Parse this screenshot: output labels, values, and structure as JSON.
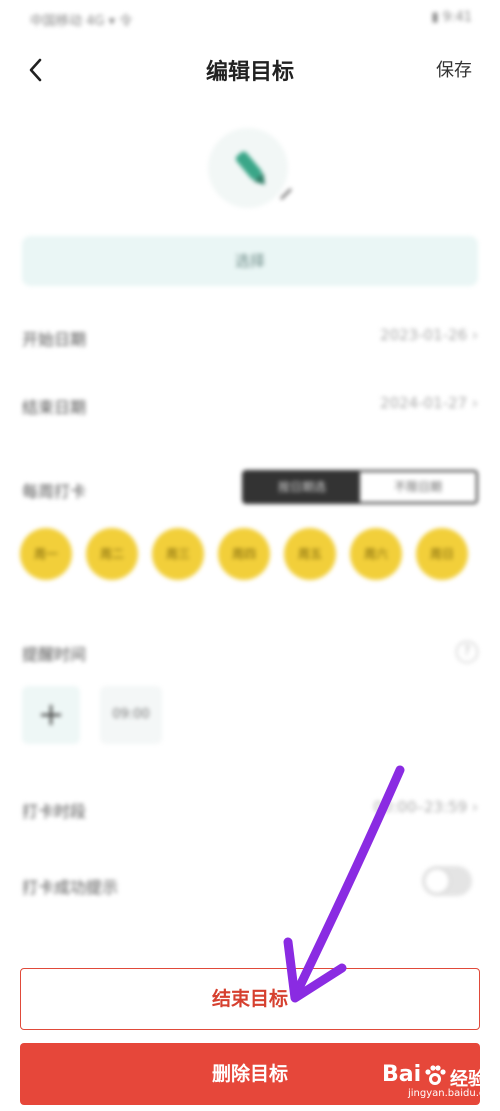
{
  "status_bar": {
    "left_text": "中国移动 4G ▾ 令",
    "right_text": "▮ 9:41"
  },
  "nav": {
    "back_icon": "chevron-left-icon",
    "title": "编辑目标",
    "save_label": "保存"
  },
  "goal": {
    "icon": "pencil-icon",
    "select_label": "选择"
  },
  "fields": {
    "start_date": {
      "label": "开始日期",
      "value": "2023-01-26 ›"
    },
    "end_date": {
      "label": "结束日期",
      "value": "2024-01-27 ›"
    }
  },
  "checkin": {
    "label": "每周打卡",
    "segments": [
      {
        "label": "按日期选",
        "active": true
      },
      {
        "label": "不限日期",
        "active": false
      }
    ],
    "days": [
      "周一",
      "周二",
      "周三",
      "周四",
      "周五",
      "周六",
      "周日"
    ],
    "day_color": "#f2cf3a"
  },
  "reminder": {
    "label": "提醒时间",
    "help_icon": "help-icon",
    "add_icon": "plus-icon",
    "time": "09:00"
  },
  "checkin_time": {
    "label": "打卡时段",
    "value": "00:00–23:59 ›"
  },
  "checkin_alert": {
    "label": "打卡成功提示",
    "toggle_on": false
  },
  "actions": {
    "end_goal": "结束目标",
    "delete_goal": "删除目标"
  },
  "colors": {
    "accent_red": "#e6473a",
    "annotation_purple": "#8a2be2"
  },
  "watermark": {
    "brand_left": "Bai",
    "brand_right": "经验",
    "url": "jingyan.baidu.com"
  }
}
